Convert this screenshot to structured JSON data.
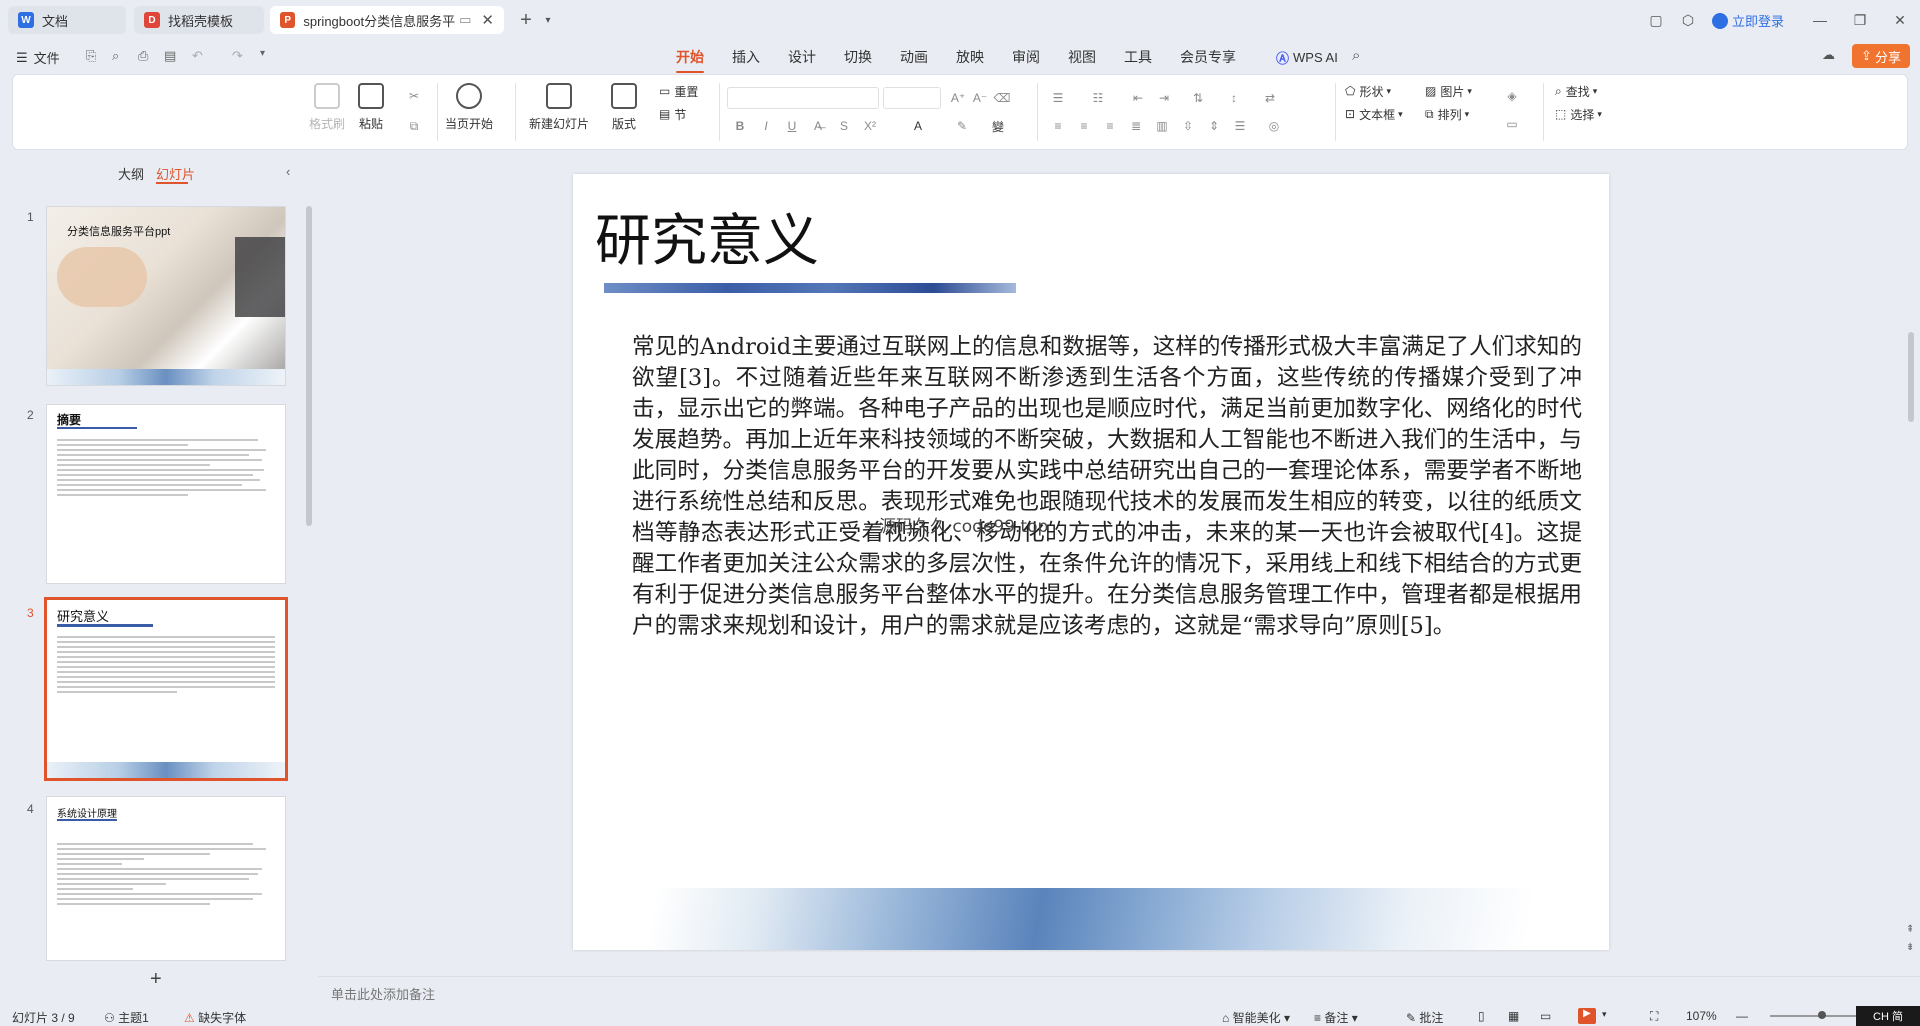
{
  "tabs": [
    {
      "label": "文档",
      "icon": "doc-icon"
    },
    {
      "label": "找稻壳模板",
      "icon": "docer-icon"
    },
    {
      "label": "springboot分类信息服务平",
      "icon": "ppt-icon"
    }
  ],
  "window": {
    "login": "立即登录",
    "share": "分享"
  },
  "menu": {
    "file": "文件",
    "items": [
      "开始",
      "插入",
      "设计",
      "切换",
      "动画",
      "放映",
      "审阅",
      "视图",
      "工具",
      "会员专享"
    ],
    "active": "开始",
    "wps_ai": "WPS AI"
  },
  "ribbon": {
    "format_painter": "格式刷",
    "paste": "粘贴",
    "play_from_current": "当页开始",
    "new_slide": "新建幻灯片",
    "layout": "版式",
    "reset": "重置",
    "section": "节",
    "shape": "形状",
    "picture": "图片",
    "textbox": "文本框",
    "arrange": "排列",
    "find": "查找",
    "select": "选择"
  },
  "panel": {
    "outline_tab": "大纲",
    "slides_tab": "幻灯片"
  },
  "thumbnails": [
    {
      "num": "1",
      "title": "分类信息服务平台ppt"
    },
    {
      "num": "2",
      "title": "摘要"
    },
    {
      "num": "3",
      "title": "研究意义"
    },
    {
      "num": "4",
      "title": "系统设计原理"
    }
  ],
  "slide": {
    "title": "研究意义",
    "body": "常见的Android主要通过互联网上的信息和数据等，这样的传播形式极大丰富满足了人们求知的欲望[3]。不过随着近些年来互联网不断渗透到生活各个方面，这些传统的传播媒介受到了冲击，显示出它的弊端。各种电子产品的出现也是顺应时代，满足当前更加数字化、网络化的时代发展趋势。再加上近年来科技领域的不断突破，大数据和人工智能也不断进入我们的生活中，与此同时，分类信息服务平台的开发要从实践中总结研究出自己的一套理论体系，需要学者不断地进行系统性总结和反思。表现形式难免也跟随现代技术的发展而发生相应的转变，以往的纸质文档等静态表达形式正受着视频化、移动化的方式的冲击，未来的某一天也许会被取代[4]。这提醒工作者更加关注公众需求的多层次性，在条件允许的情况下，采用线上和线下相结合的方式更有利于促进分类信息服务平台整体水平的提升。在分类信息服务管理工作中，管理者都是根据用户的需求来规划和设计，用户的需求就是应该考虑的，这就是“需求导向”原则[5]。",
    "watermark": "源码久久 code99.top"
  },
  "notes_placeholder": "单击此处添加备注",
  "status": {
    "slide_counter": "幻灯片 3 / 9",
    "theme": "主题1",
    "missing_font": "缺失字体",
    "beautify": "智能美化",
    "notes": "备注",
    "comments": "批注",
    "zoom": "107%",
    "ime": "CH 简"
  },
  "colors": {
    "accent": "#e0542c",
    "share_bg": "#f0742f"
  }
}
